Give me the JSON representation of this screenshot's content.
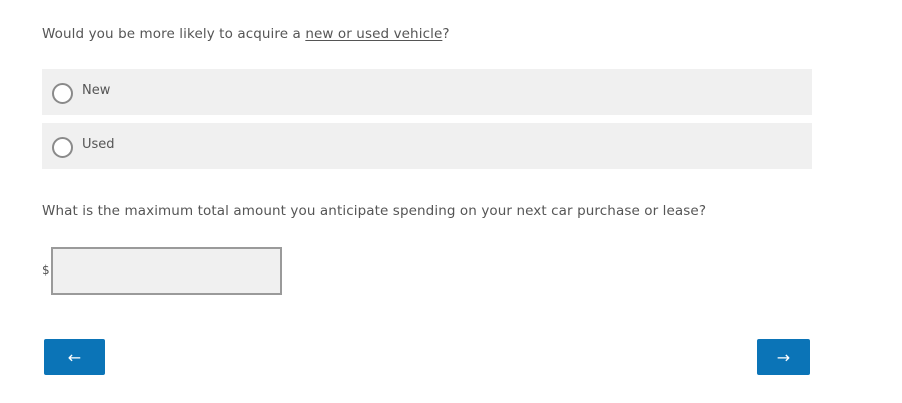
{
  "question_1": {
    "prefix": "Would you be more likely to acquire a ",
    "link_text": "new or used vehicle",
    "suffix": "?",
    "options": [
      {
        "label": "New",
        "selected": false
      },
      {
        "label": "Used",
        "selected": false
      }
    ]
  },
  "question_2": {
    "text": "What is the maximum total amount you anticipate spending on your next car purchase or lease?",
    "currency_symbol": "$",
    "value": ""
  },
  "navigation": {
    "back_label": "←",
    "next_label": "→",
    "button_color": "#0b74b7"
  }
}
